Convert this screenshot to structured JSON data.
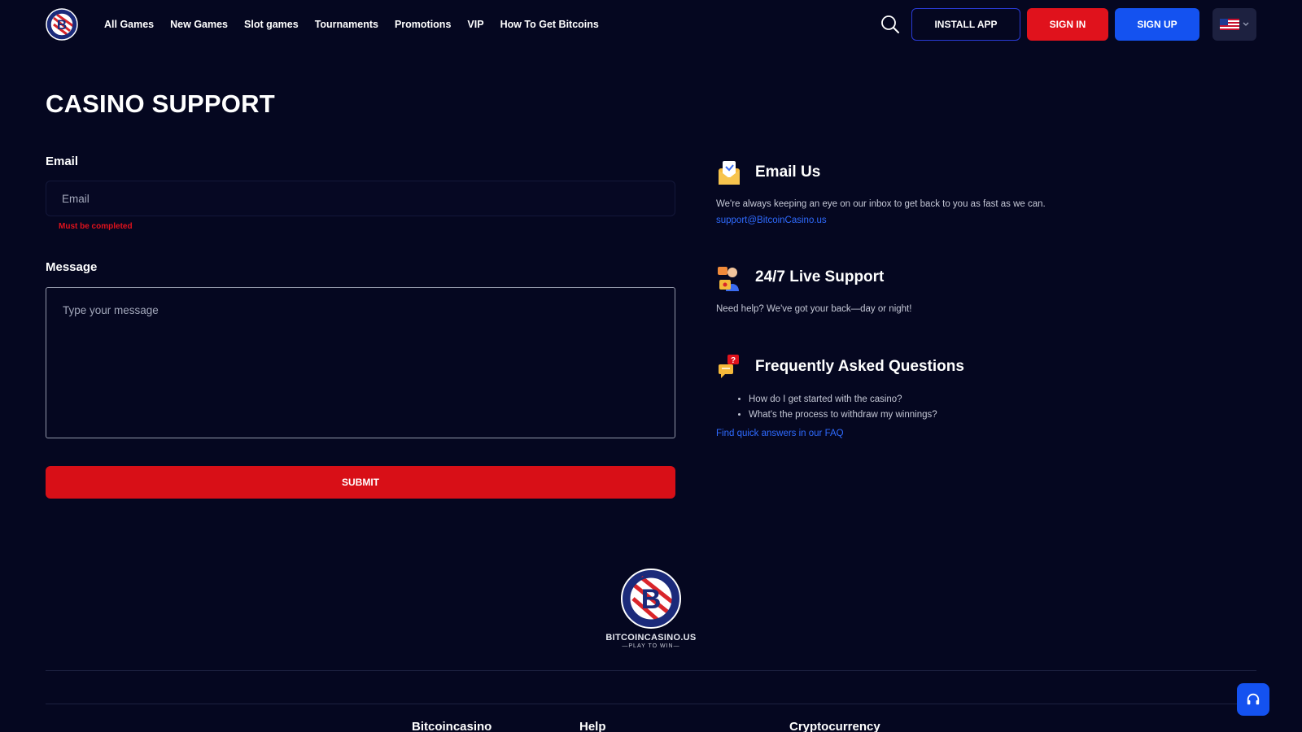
{
  "header": {
    "nav": [
      "All Games",
      "New Games",
      "Slot games",
      "Tournaments",
      "Promotions",
      "VIP",
      "How To Get Bitcoins"
    ],
    "install_label": "INSTALL APP",
    "signin_label": "SIGN IN",
    "signup_label": "SIGN UP",
    "language": "us-flag-icon"
  },
  "page": {
    "title": "CASINO SUPPORT"
  },
  "form": {
    "email_label": "Email",
    "email_placeholder": "Email",
    "email_value": "",
    "email_error": "Must be completed",
    "message_label": "Message",
    "message_placeholder": "Type your message",
    "message_value": "",
    "submit_label": "SUBMIT"
  },
  "contact": {
    "email_us": {
      "title": "Email Us",
      "description": "We're always keeping an eye on our inbox to get back to you as fast as we can.",
      "link": "support@BitcoinCasino.us"
    },
    "live_support": {
      "title": "24/7 Live Support",
      "description": "Need help? We've got your back—day or night!"
    },
    "faq": {
      "title": "Frequently Asked Questions",
      "items": [
        "How do I get started with the casino?",
        "What's the process to withdraw my winnings?"
      ],
      "link": "Find quick answers in our FAQ"
    }
  },
  "footer": {
    "brand": "BITCOINCASINO.US",
    "tagline": "—PLAY TO WIN—",
    "columns": [
      "Bitcoincasino",
      "Help",
      "Cryptocurrency"
    ]
  },
  "colors": {
    "background": "#050720",
    "red": "#e0121c",
    "blue": "#1452f0",
    "link": "#2f6bff"
  }
}
